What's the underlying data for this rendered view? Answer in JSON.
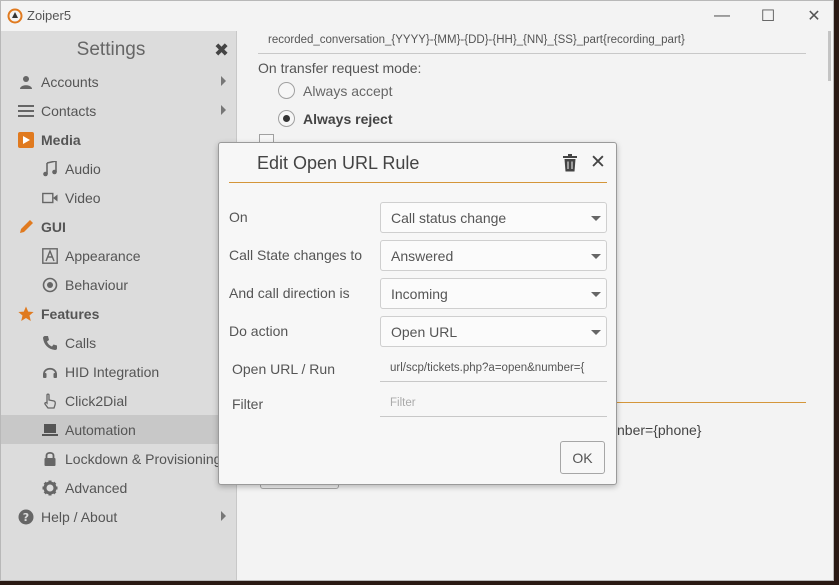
{
  "window": {
    "title": "Zoiper5",
    "minimize_label": "—",
    "maximize_label": "☐",
    "close_label": "✕"
  },
  "sidebar": {
    "title": "Settings",
    "close_label": "✖",
    "items": [
      {
        "label": "Accounts"
      },
      {
        "label": "Contacts"
      },
      {
        "label": "Media"
      },
      {
        "label": "Audio"
      },
      {
        "label": "Video"
      },
      {
        "label": "GUI"
      },
      {
        "label": "Appearance"
      },
      {
        "label": "Behaviour"
      },
      {
        "label": "Features"
      },
      {
        "label": "Calls"
      },
      {
        "label": "HID Integration"
      },
      {
        "label": "Click2Dial"
      },
      {
        "label": "Automation"
      },
      {
        "label": "Lockdown & Provisioning"
      },
      {
        "label": "Advanced"
      },
      {
        "label": "Help / About"
      }
    ],
    "accent_color": "#e07a1f"
  },
  "content": {
    "recording_path": "recorded_conversation_{YYYY}-{MM}-{DD}-{HH}_{NN}_{SS}_part{recording_part}",
    "transfer_label": "On transfer request mode:",
    "radio_accept": "Always accept",
    "radio_reject": "Always reject",
    "behind_text": "nber={phone}"
  },
  "dialog": {
    "title": "Edit Open URL Rule",
    "close_label": "✕",
    "rows": {
      "on_label": "On",
      "on_value": "Call status change",
      "state_label": "Call State changes to",
      "state_value": "Answered",
      "direction_label": "And call direction is",
      "direction_value": "Incoming",
      "action_label": "Do action",
      "action_value": "Open URL",
      "url_label": "Open URL / Run",
      "url_value": "url/scp/tickets.php?a=open&number={",
      "filter_label": "Filter",
      "filter_placeholder": "Filter"
    },
    "ok_label": "OK",
    "accent_color": "#d4963a"
  }
}
